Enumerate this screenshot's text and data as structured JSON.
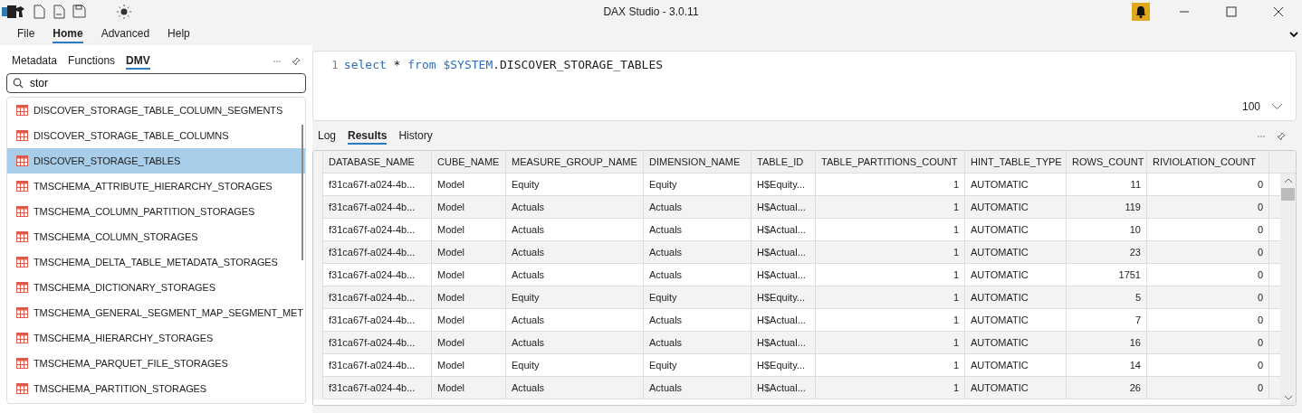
{
  "window": {
    "title": "DAX Studio - 3.0.11"
  },
  "menu": [
    {
      "label": "File",
      "selected": false
    },
    {
      "label": "Home",
      "selected": true
    },
    {
      "label": "Advanced",
      "selected": false
    },
    {
      "label": "Help",
      "selected": false
    }
  ],
  "left_panel": {
    "tabs": [
      {
        "label": "Metadata",
        "selected": false
      },
      {
        "label": "Functions",
        "selected": false
      },
      {
        "label": "DMV",
        "selected": true
      }
    ],
    "search": {
      "value": "stor"
    },
    "items": [
      {
        "label": "DISCOVER_STORAGE_TABLE_COLUMN_SEGMENTS",
        "selected": false
      },
      {
        "label": "DISCOVER_STORAGE_TABLE_COLUMNS",
        "selected": false
      },
      {
        "label": "DISCOVER_STORAGE_TABLES",
        "selected": true
      },
      {
        "label": "TMSCHEMA_ATTRIBUTE_HIERARCHY_STORAGES",
        "selected": false
      },
      {
        "label": "TMSCHEMA_COLUMN_PARTITION_STORAGES",
        "selected": false
      },
      {
        "label": "TMSCHEMA_COLUMN_STORAGES",
        "selected": false
      },
      {
        "label": "TMSCHEMA_DELTA_TABLE_METADATA_STORAGES",
        "selected": false
      },
      {
        "label": "TMSCHEMA_DICTIONARY_STORAGES",
        "selected": false
      },
      {
        "label": "TMSCHEMA_GENERAL_SEGMENT_MAP_SEGMENT_MET",
        "selected": false
      },
      {
        "label": "TMSCHEMA_HIERARCHY_STORAGES",
        "selected": false
      },
      {
        "label": "TMSCHEMA_PARQUET_FILE_STORAGES",
        "selected": false
      },
      {
        "label": "TMSCHEMA_PARTITION_STORAGES",
        "selected": false
      }
    ]
  },
  "editor": {
    "line_number": "1",
    "tokens": [
      {
        "text": "select",
        "kind": "keyword"
      },
      {
        "text": "*",
        "kind": "plain"
      },
      {
        "text": "from",
        "kind": "keyword"
      },
      {
        "text": "$SYSTEM",
        "kind": "keyword"
      },
      {
        "text": ".DISCOVER_STORAGE_TABLES",
        "kind": "plain"
      }
    ],
    "row_limit": "100"
  },
  "output_tabs": [
    {
      "label": "Log",
      "selected": false
    },
    {
      "label": "Results",
      "selected": true
    },
    {
      "label": "History",
      "selected": false
    }
  ],
  "table": {
    "columns": [
      {
        "label": "DATABASE_NAME",
        "kind": "text"
      },
      {
        "label": "CUBE_NAME",
        "kind": "text"
      },
      {
        "label": "MEASURE_GROUP_NAME",
        "kind": "text"
      },
      {
        "label": "DIMENSION_NAME",
        "kind": "text"
      },
      {
        "label": "TABLE_ID",
        "kind": "text"
      },
      {
        "label": "TABLE_PARTITIONS_COUNT",
        "kind": "number"
      },
      {
        "label": "HINT_TABLE_TYPE",
        "kind": "text"
      },
      {
        "label": "ROWS_COUNT",
        "kind": "number"
      },
      {
        "label": "RIVIOLATION_COUNT",
        "kind": "number"
      }
    ],
    "rows": [
      [
        "f31ca67f-a024-4b...",
        "Model",
        "Equity",
        "Equity",
        "H$Equity...",
        "1",
        "AUTOMATIC",
        "11",
        "0"
      ],
      [
        "f31ca67f-a024-4b...",
        "Model",
        "Actuals",
        "Actuals",
        "H$Actual...",
        "1",
        "AUTOMATIC",
        "119",
        "0"
      ],
      [
        "f31ca67f-a024-4b...",
        "Model",
        "Actuals",
        "Actuals",
        "H$Actual...",
        "1",
        "AUTOMATIC",
        "10",
        "0"
      ],
      [
        "f31ca67f-a024-4b...",
        "Model",
        "Actuals",
        "Actuals",
        "H$Actual...",
        "1",
        "AUTOMATIC",
        "23",
        "0"
      ],
      [
        "f31ca67f-a024-4b...",
        "Model",
        "Actuals",
        "Actuals",
        "H$Actual...",
        "1",
        "AUTOMATIC",
        "1751",
        "0"
      ],
      [
        "f31ca67f-a024-4b...",
        "Model",
        "Equity",
        "Equity",
        "H$Equity...",
        "1",
        "AUTOMATIC",
        "5",
        "0"
      ],
      [
        "f31ca67f-a024-4b...",
        "Model",
        "Actuals",
        "Actuals",
        "H$Actual...",
        "1",
        "AUTOMATIC",
        "7",
        "0"
      ],
      [
        "f31ca67f-a024-4b...",
        "Model",
        "Actuals",
        "Actuals",
        "H$Actual...",
        "1",
        "AUTOMATIC",
        "16",
        "0"
      ],
      [
        "f31ca67f-a024-4b...",
        "Model",
        "Equity",
        "Equity",
        "H$Equity...",
        "1",
        "AUTOMATIC",
        "14",
        "0"
      ],
      [
        "f31ca67f-a024-4b...",
        "Model",
        "Actuals",
        "Actuals",
        "H$Actual...",
        "1",
        "AUTOMATIC",
        "26",
        "0"
      ]
    ]
  }
}
